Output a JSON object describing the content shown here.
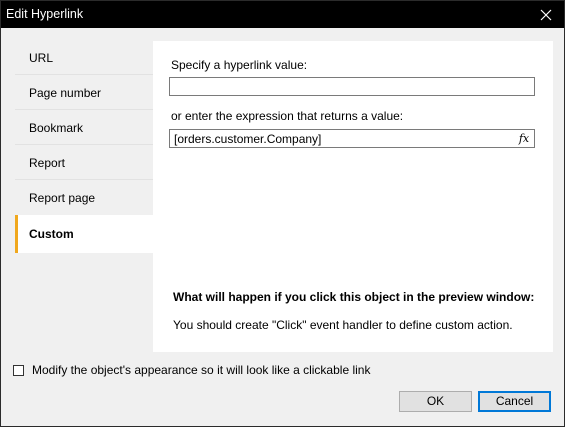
{
  "window": {
    "title": "Edit Hyperlink"
  },
  "sidebar": {
    "items": [
      {
        "label": "URL"
      },
      {
        "label": "Page number"
      },
      {
        "label": "Bookmark"
      },
      {
        "label": "Report"
      },
      {
        "label": "Report page"
      },
      {
        "label": "Custom"
      }
    ],
    "selected": "Custom"
  },
  "panel": {
    "value_label": "Specify a hyperlink value:",
    "value_input": "",
    "expression_label": "or enter the expression that returns a value:",
    "expression_input": "[orders.customer.Company]",
    "fx_button": "fx",
    "info_title": "What will happen if you click this object in the preview window:",
    "info_text": "You should create \"Click\" event handler to define custom action."
  },
  "footer": {
    "checkbox_label": "Modify the object's appearance so it will look like a clickable link",
    "checkbox_checked": false,
    "ok_label": "OK",
    "cancel_label": "Cancel"
  },
  "colors": {
    "accent": "#f0a81e",
    "titlebar": "#000000",
    "focus": "#0078d7"
  }
}
